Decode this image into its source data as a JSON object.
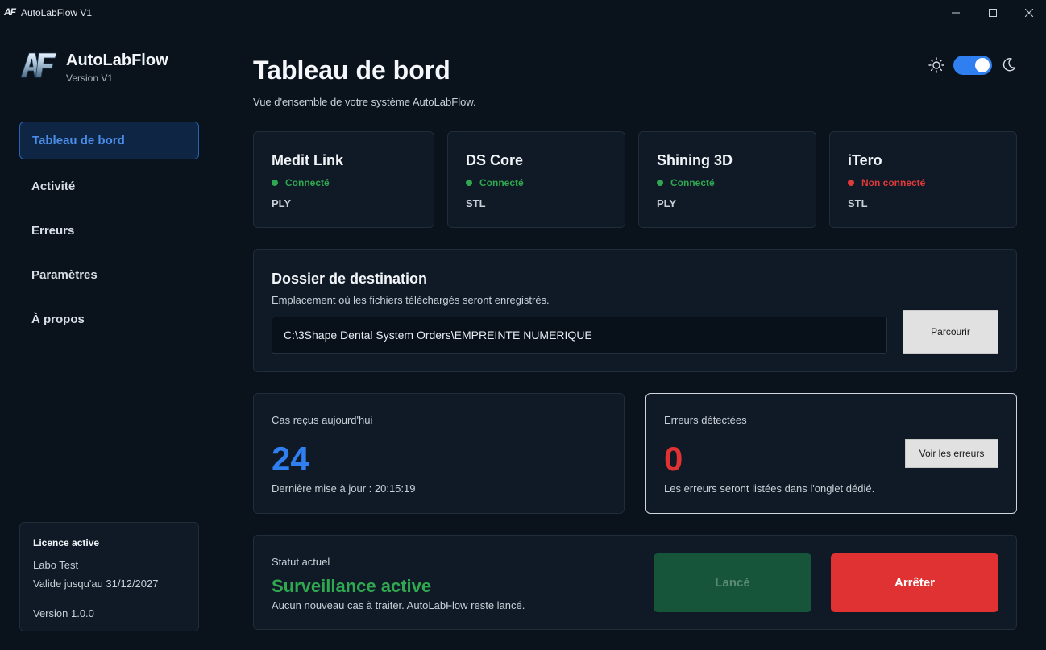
{
  "window": {
    "icon_text": "AF",
    "title": "AutoLabFlow V1",
    "minimize": "—",
    "maximize": "☐",
    "close": "✕"
  },
  "sidebar": {
    "brand_name": "AutoLabFlow",
    "brand_version": "Version V1",
    "items": [
      {
        "label": "Tableau de bord",
        "active": true
      },
      {
        "label": "Activité",
        "active": false
      },
      {
        "label": "Erreurs",
        "active": false
      },
      {
        "label": "Paramètres",
        "active": false
      },
      {
        "label": "À propos",
        "active": false
      }
    ],
    "license": {
      "title": "Licence active",
      "lab": "Labo Test",
      "validity": "Valide jusqu'au 31/12/2027",
      "version": "Version 1.0.0"
    }
  },
  "header": {
    "title": "Tableau de bord",
    "subtitle": "Vue d'ensemble de votre système AutoLabFlow.",
    "theme_toggle_on": true
  },
  "services": [
    {
      "name": "Medit Link",
      "status": "Connecté",
      "connected": true,
      "format": "PLY"
    },
    {
      "name": "DS Core",
      "status": "Connecté",
      "connected": true,
      "format": "STL"
    },
    {
      "name": "Shining 3D",
      "status": "Connecté",
      "connected": true,
      "format": "PLY"
    },
    {
      "name": "iTero",
      "status": "Non connecté",
      "connected": false,
      "format": "STL"
    }
  ],
  "destination": {
    "title": "Dossier de destination",
    "description": "Emplacement où les fichiers téléchargés seront enregistrés.",
    "path": "C:\\3Shape Dental System Orders\\EMPREINTE NUMERIQUE",
    "browse_label": "Parcourir"
  },
  "cases": {
    "label": "Cas reçus aujourd'hui",
    "value": "24",
    "updated": "Dernière mise à jour : 20:15:19"
  },
  "errors": {
    "label": "Erreurs détectées",
    "value": "0",
    "description": "Les erreurs seront listées dans l'onglet dédié.",
    "button_label": "Voir les erreurs"
  },
  "status": {
    "label": "Statut actuel",
    "value": "Surveillance active",
    "description": "Aucun nouveau cas à traiter. AutoLabFlow reste lancé.",
    "launched_label": "Lancé",
    "stop_label": "Arrêter"
  },
  "colors": {
    "accent": "#2f7ff0",
    "success": "#2fa84f",
    "danger": "#e03232",
    "background": "#0a121c",
    "card": "#0f1a26"
  }
}
